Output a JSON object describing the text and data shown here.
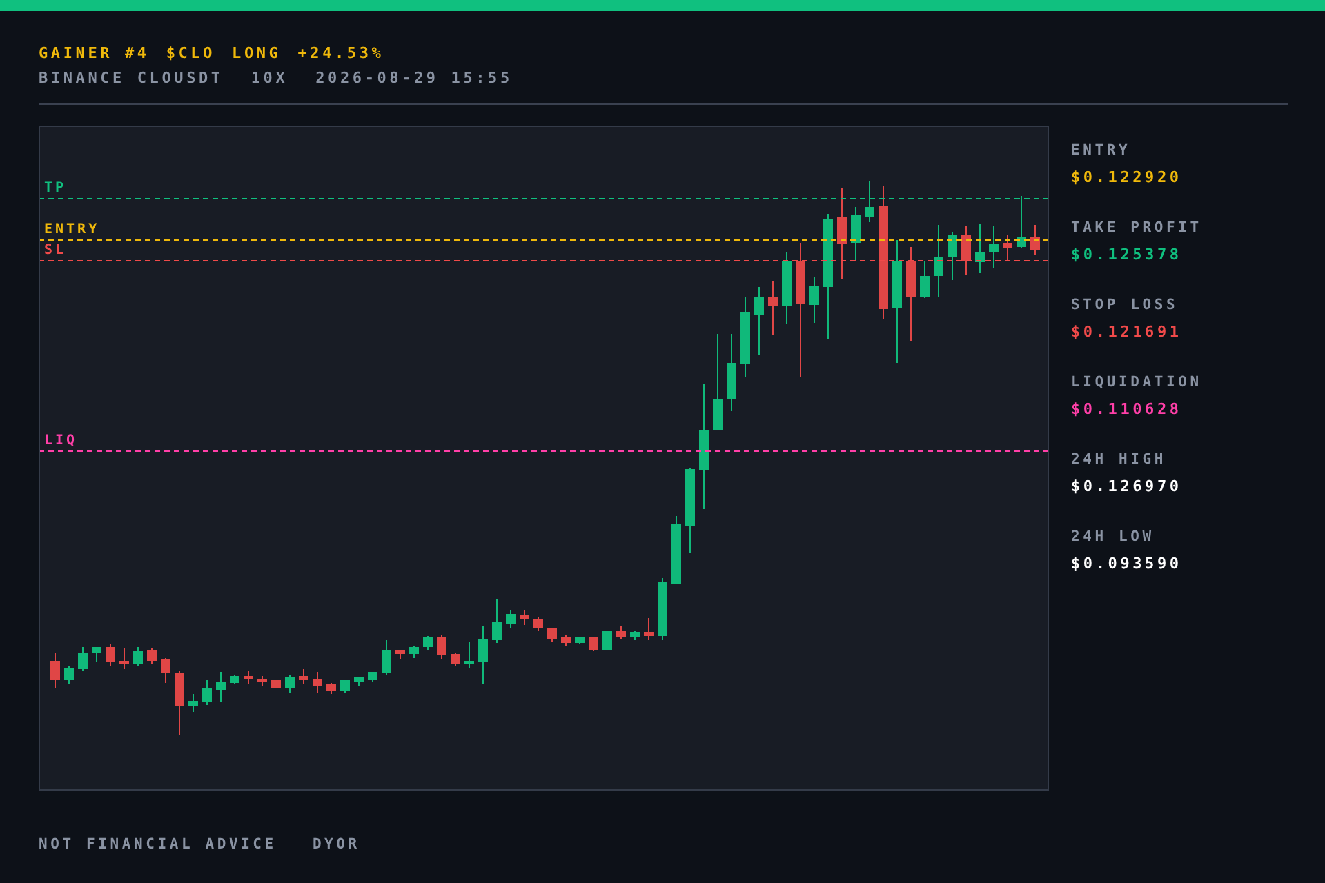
{
  "header": {
    "title": [
      "GAINER #4",
      "$CLO",
      "LONG",
      "+24.53%"
    ],
    "subtitle": [
      "BINANCE CLOUSDT",
      "10X",
      "2026-08-29 15:55"
    ]
  },
  "chart": {
    "levels": [
      {
        "label": "TP",
        "color": "#10c07f"
      },
      {
        "label": "ENTRY",
        "color": "#f0b90b"
      },
      {
        "label": "SL",
        "color": "#f04a4a"
      },
      {
        "label": "LIQ",
        "color": "#ff3fa8"
      }
    ]
  },
  "stats": [
    {
      "label": "ENTRY",
      "value": "$0.122920",
      "color": "#f0b90b"
    },
    {
      "label": "TAKE PROFIT",
      "value": "$0.125378",
      "color": "#10c07f"
    },
    {
      "label": "STOP LOSS",
      "value": "$0.121691",
      "color": "#f04a4a"
    },
    {
      "label": "LIQUIDATION",
      "value": "$0.110628",
      "color": "#ff3fa8"
    },
    {
      "label": "24H HIGH",
      "value": "$0.126970",
      "color": "#ffffff"
    },
    {
      "label": "24H LOW",
      "value": "$0.093590",
      "color": "#ffffff"
    }
  ],
  "footer": [
    "NOT FINANCIAL ADVICE",
    "DYOR"
  ]
}
